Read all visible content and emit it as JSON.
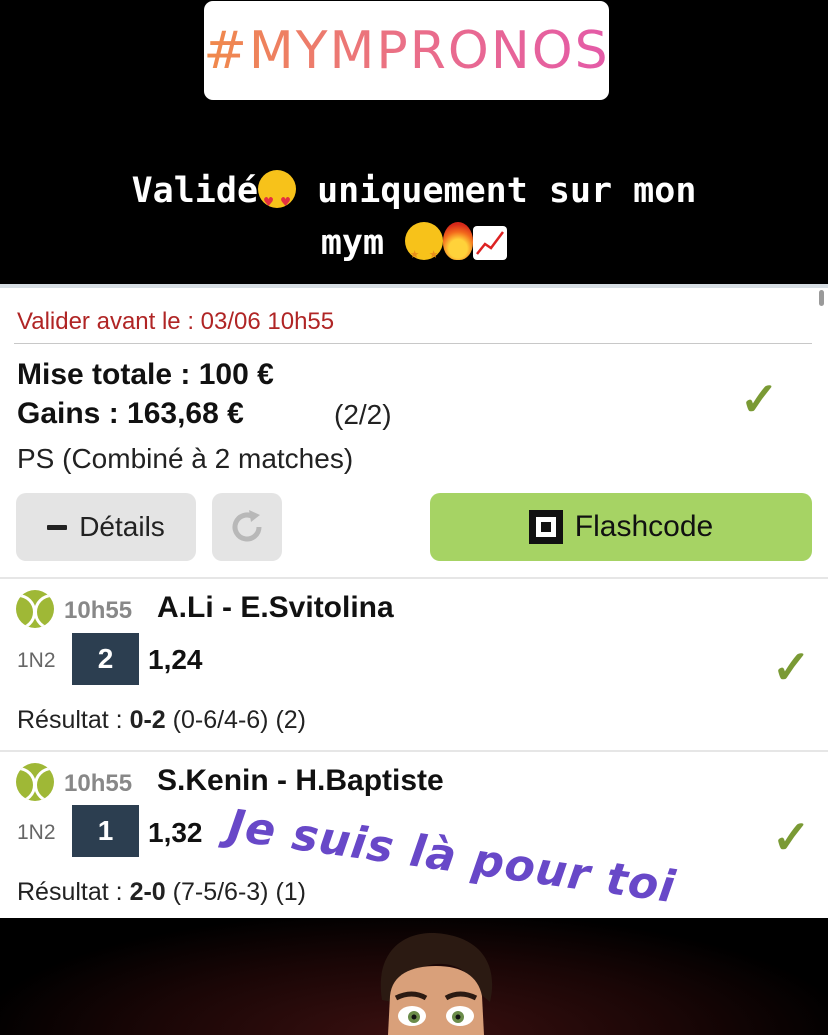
{
  "hashtag": "#MYMPRONOS",
  "caption": {
    "word1": "Validé",
    "line1_rest": "uniquement sur mon",
    "line2": "mym",
    "emoji_icons": [
      "heart-eyes-icon",
      "star-struck-icon",
      "fire-icon",
      "chart-increasing-icon"
    ]
  },
  "bet": {
    "deadline": "Valider avant le : 03/06 10h55",
    "stake": "Mise totale : 100 €",
    "gains": "Gains : 163,68 €",
    "count": "(2/2)",
    "type": "PS (Combiné à 2 matches)",
    "status_icon": "check-icon",
    "buttons": {
      "details": "Détails",
      "flashcode": "Flashcode"
    }
  },
  "matches": [
    {
      "time": "10h55",
      "teams": "A.Li - E.Svitolina",
      "bet_type": "1N2",
      "pick": "2",
      "odds": "1,24",
      "result_label": "Résultat : ",
      "score": "0-2",
      "detail": " (0-6/4-6) (2)"
    },
    {
      "time": "10h55",
      "teams": "S.Kenin - H.Baptiste",
      "bet_type": "1N2",
      "pick": "1",
      "odds": "1,32",
      "result_label": "Résultat : ",
      "score": "2-0",
      "detail": " (7-5/6-3) (1)"
    }
  ],
  "sticker": "Je suis là pour toi",
  "colors": {
    "accent_green": "#a6d364",
    "check_green": "#7a9a34",
    "deadline_red": "#b02525",
    "pick_navy": "#2c3e50",
    "sticker_purple": "#6848c8"
  }
}
